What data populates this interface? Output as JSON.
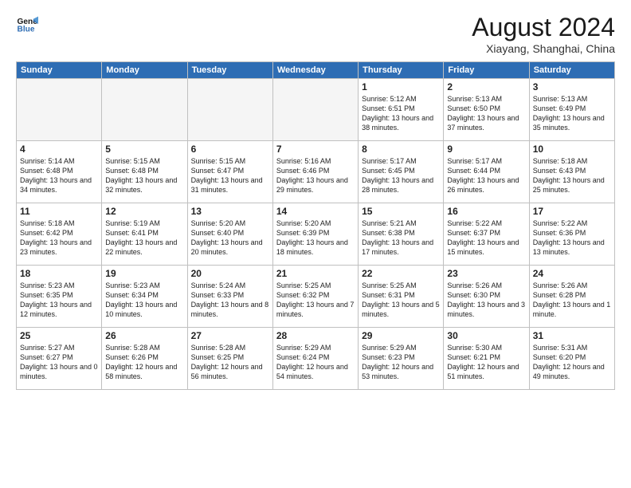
{
  "logo": {
    "line1": "General",
    "line2": "Blue"
  },
  "title": "August 2024",
  "location": "Xiayang, Shanghai, China",
  "weekdays": [
    "Sunday",
    "Monday",
    "Tuesday",
    "Wednesday",
    "Thursday",
    "Friday",
    "Saturday"
  ],
  "weeks": [
    [
      {
        "day": "",
        "empty": true
      },
      {
        "day": "",
        "empty": true
      },
      {
        "day": "",
        "empty": true
      },
      {
        "day": "",
        "empty": true
      },
      {
        "day": "1",
        "sunrise": "5:12 AM",
        "sunset": "6:51 PM",
        "daylight": "13 hours and 38 minutes."
      },
      {
        "day": "2",
        "sunrise": "5:13 AM",
        "sunset": "6:50 PM",
        "daylight": "13 hours and 37 minutes."
      },
      {
        "day": "3",
        "sunrise": "5:13 AM",
        "sunset": "6:49 PM",
        "daylight": "13 hours and 35 minutes."
      }
    ],
    [
      {
        "day": "4",
        "sunrise": "5:14 AM",
        "sunset": "6:48 PM",
        "daylight": "13 hours and 34 minutes."
      },
      {
        "day": "5",
        "sunrise": "5:15 AM",
        "sunset": "6:48 PM",
        "daylight": "13 hours and 32 minutes."
      },
      {
        "day": "6",
        "sunrise": "5:15 AM",
        "sunset": "6:47 PM",
        "daylight": "13 hours and 31 minutes."
      },
      {
        "day": "7",
        "sunrise": "5:16 AM",
        "sunset": "6:46 PM",
        "daylight": "13 hours and 29 minutes."
      },
      {
        "day": "8",
        "sunrise": "5:17 AM",
        "sunset": "6:45 PM",
        "daylight": "13 hours and 28 minutes."
      },
      {
        "day": "9",
        "sunrise": "5:17 AM",
        "sunset": "6:44 PM",
        "daylight": "13 hours and 26 minutes."
      },
      {
        "day": "10",
        "sunrise": "5:18 AM",
        "sunset": "6:43 PM",
        "daylight": "13 hours and 25 minutes."
      }
    ],
    [
      {
        "day": "11",
        "sunrise": "5:18 AM",
        "sunset": "6:42 PM",
        "daylight": "13 hours and 23 minutes."
      },
      {
        "day": "12",
        "sunrise": "5:19 AM",
        "sunset": "6:41 PM",
        "daylight": "13 hours and 22 minutes."
      },
      {
        "day": "13",
        "sunrise": "5:20 AM",
        "sunset": "6:40 PM",
        "daylight": "13 hours and 20 minutes."
      },
      {
        "day": "14",
        "sunrise": "5:20 AM",
        "sunset": "6:39 PM",
        "daylight": "13 hours and 18 minutes."
      },
      {
        "day": "15",
        "sunrise": "5:21 AM",
        "sunset": "6:38 PM",
        "daylight": "13 hours and 17 minutes."
      },
      {
        "day": "16",
        "sunrise": "5:22 AM",
        "sunset": "6:37 PM",
        "daylight": "13 hours and 15 minutes."
      },
      {
        "day": "17",
        "sunrise": "5:22 AM",
        "sunset": "6:36 PM",
        "daylight": "13 hours and 13 minutes."
      }
    ],
    [
      {
        "day": "18",
        "sunrise": "5:23 AM",
        "sunset": "6:35 PM",
        "daylight": "13 hours and 12 minutes."
      },
      {
        "day": "19",
        "sunrise": "5:23 AM",
        "sunset": "6:34 PM",
        "daylight": "13 hours and 10 minutes."
      },
      {
        "day": "20",
        "sunrise": "5:24 AM",
        "sunset": "6:33 PM",
        "daylight": "13 hours and 8 minutes."
      },
      {
        "day": "21",
        "sunrise": "5:25 AM",
        "sunset": "6:32 PM",
        "daylight": "13 hours and 7 minutes."
      },
      {
        "day": "22",
        "sunrise": "5:25 AM",
        "sunset": "6:31 PM",
        "daylight": "13 hours and 5 minutes."
      },
      {
        "day": "23",
        "sunrise": "5:26 AM",
        "sunset": "6:30 PM",
        "daylight": "13 hours and 3 minutes."
      },
      {
        "day": "24",
        "sunrise": "5:26 AM",
        "sunset": "6:28 PM",
        "daylight": "13 hours and 1 minute."
      }
    ],
    [
      {
        "day": "25",
        "sunrise": "5:27 AM",
        "sunset": "6:27 PM",
        "daylight": "13 hours and 0 minutes."
      },
      {
        "day": "26",
        "sunrise": "5:28 AM",
        "sunset": "6:26 PM",
        "daylight": "12 hours and 58 minutes."
      },
      {
        "day": "27",
        "sunrise": "5:28 AM",
        "sunset": "6:25 PM",
        "daylight": "12 hours and 56 minutes."
      },
      {
        "day": "28",
        "sunrise": "5:29 AM",
        "sunset": "6:24 PM",
        "daylight": "12 hours and 54 minutes."
      },
      {
        "day": "29",
        "sunrise": "5:29 AM",
        "sunset": "6:23 PM",
        "daylight": "12 hours and 53 minutes."
      },
      {
        "day": "30",
        "sunrise": "5:30 AM",
        "sunset": "6:21 PM",
        "daylight": "12 hours and 51 minutes."
      },
      {
        "day": "31",
        "sunrise": "5:31 AM",
        "sunset": "6:20 PM",
        "daylight": "12 hours and 49 minutes."
      }
    ]
  ]
}
